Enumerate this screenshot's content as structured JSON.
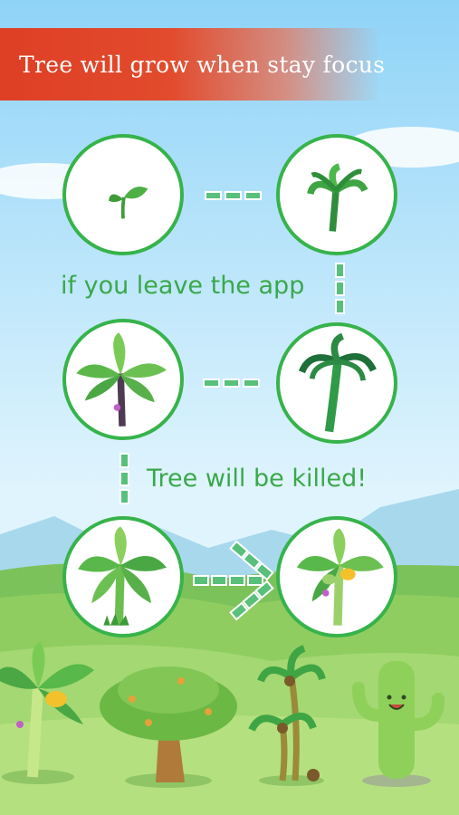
{
  "banner": {
    "text": "Tree will grow when stay focus"
  },
  "messages": {
    "leave": "if you leave the app",
    "killed": "Tree will be killed!"
  },
  "colors": {
    "banner_red": "#de3f25",
    "accent_green": "#36b34a",
    "label_green": "#3aa84a"
  },
  "stages": [
    {
      "icon": "sprout-icon"
    },
    {
      "icon": "small-palm-icon"
    },
    {
      "icon": "banana-plant-icon"
    },
    {
      "icon": "young-palm-icon"
    },
    {
      "icon": "banana-tree-icon"
    },
    {
      "icon": "fruit-banana-tree-icon"
    }
  ]
}
